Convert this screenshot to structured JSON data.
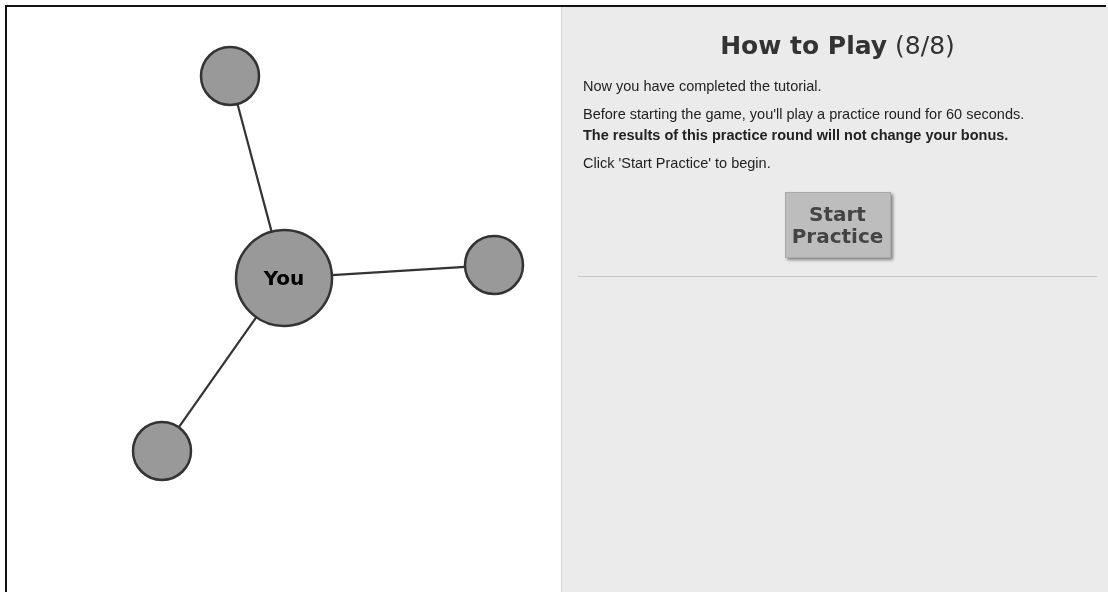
{
  "network": {
    "nodes": [
      {
        "kind": "self",
        "label": "You"
      },
      {
        "kind": "neighbor"
      },
      {
        "kind": "neighbor"
      },
      {
        "kind": "neighbor"
      }
    ]
  },
  "instructions": {
    "title": "**How to Play** (8/8)",
    "paragraphs": [
      "Now you have completed the tutorial.",
      "Before starting the game, you'll play a practice round for 60 seconds. **The results of this practice round will not change your bonus.**",
      "Click 'Start Practice' to begin."
    ],
    "button": "Start Practice"
  }
}
